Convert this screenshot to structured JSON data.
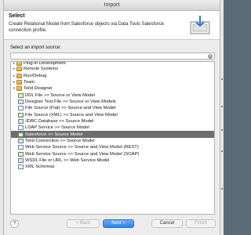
{
  "window": {
    "title": "Import"
  },
  "banner": {
    "title": "Select",
    "description": "Create Relational Model from Salesforce objects via Data Tools Salesforce connection profile."
  },
  "source": {
    "label": "Select an import source:",
    "filter_value": ""
  },
  "tree": {
    "items": [
      {
        "label": "Plug-in Development",
        "kind": "folder",
        "level": 0,
        "expanded": false,
        "partial": true
      },
      {
        "label": "Remote Systems",
        "kind": "folder",
        "level": 0,
        "expanded": false
      },
      {
        "label": "Run/Debug",
        "kind": "folder",
        "level": 0,
        "expanded": false
      },
      {
        "label": "Team",
        "kind": "folder",
        "level": 0,
        "expanded": false
      },
      {
        "label": "Teiid Designer",
        "kind": "folder",
        "level": 0,
        "expanded": true
      },
      {
        "label": "DDL File >> Source or View Model",
        "kind": "doc",
        "level": 1
      },
      {
        "label": "Designer Text File >> Source or View Models",
        "kind": "doc",
        "level": 1
      },
      {
        "label": "File Source (Flat) >> Source and View Model",
        "kind": "doc",
        "level": 1
      },
      {
        "label": "File Source (XML) >> Source and View Model",
        "kind": "doc",
        "level": 1
      },
      {
        "label": "JDBC Database >> Source Model",
        "kind": "doc",
        "level": 1
      },
      {
        "label": "LDAP Service >> Source Model",
        "kind": "doc",
        "level": 1
      },
      {
        "label": "Salesforce >> Source Model",
        "kind": "doc",
        "level": 1,
        "selected": true
      },
      {
        "label": "Teiid Connection >> Source Model",
        "kind": "doc",
        "level": 1
      },
      {
        "label": "Web Service Source >> Source and View Model (REST)",
        "kind": "doc",
        "level": 1
      },
      {
        "label": "Web Service Source >> Source and View Model (SOAP)",
        "kind": "doc",
        "level": 1
      },
      {
        "label": "WSDL File or URL >> Web Service Model",
        "kind": "doc",
        "level": 1
      },
      {
        "label": "XML Schemas",
        "kind": "doc",
        "level": 1
      }
    ]
  },
  "buttons": {
    "help": "?",
    "back": "< Back",
    "next": "Next >",
    "cancel": "Cancel",
    "finish": "Finish"
  }
}
